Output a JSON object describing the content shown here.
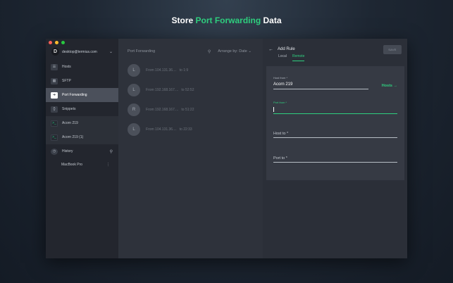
{
  "headline": {
    "prefix": "Store ",
    "accent": "Port Forwarding",
    "suffix": " Data"
  },
  "sidebar": {
    "account": {
      "avatar_letter": "D",
      "email": "desktop@termius.com"
    },
    "items": [
      {
        "label": "Hosts",
        "icon": "hosts-icon",
        "glyph": "☰"
      },
      {
        "label": "SFTP",
        "icon": "sftp-icon",
        "glyph": "▦"
      },
      {
        "label": "Port Forwarding",
        "icon": "port-forwarding-icon",
        "glyph": "➔"
      },
      {
        "label": "Snippets",
        "icon": "snippets-icon",
        "glyph": "{}"
      },
      {
        "label": "Acorn 219",
        "icon": "terminal-icon",
        "glyph": ">_"
      },
      {
        "label": "Acorn 219 (1)",
        "icon": "terminal-icon",
        "glyph": ">_"
      }
    ],
    "history": {
      "label": "History",
      "host": "MacBook Pro"
    }
  },
  "list": {
    "title": "Port Forwarding",
    "arrange": "Arrange by: Date",
    "rules": [
      {
        "badge": "L",
        "from": "From 104.131.36....",
        "to": "to 1:9"
      },
      {
        "badge": "L",
        "from": "From 192.168.167....",
        "to": "to 52:52"
      },
      {
        "badge": "R",
        "from": "From 192.168.167....",
        "to": "to 51:22"
      },
      {
        "badge": "L",
        "from": "From 104.131.36....",
        "to": "to 22:33"
      }
    ]
  },
  "panel": {
    "title": "Add Rule",
    "save_label": "SAVE",
    "tabs": [
      {
        "label": "Local"
      },
      {
        "label": "Remote"
      }
    ],
    "active_tab": "Remote",
    "host_from_label": "Host from *",
    "host_from_value": "Acorn 219",
    "hosts_link": "Hosts",
    "port_from_label": "Port from *",
    "host_to_label": "Host to *",
    "port_to_label": "Port to *"
  },
  "colors": {
    "accent": "#2fcf7f"
  }
}
